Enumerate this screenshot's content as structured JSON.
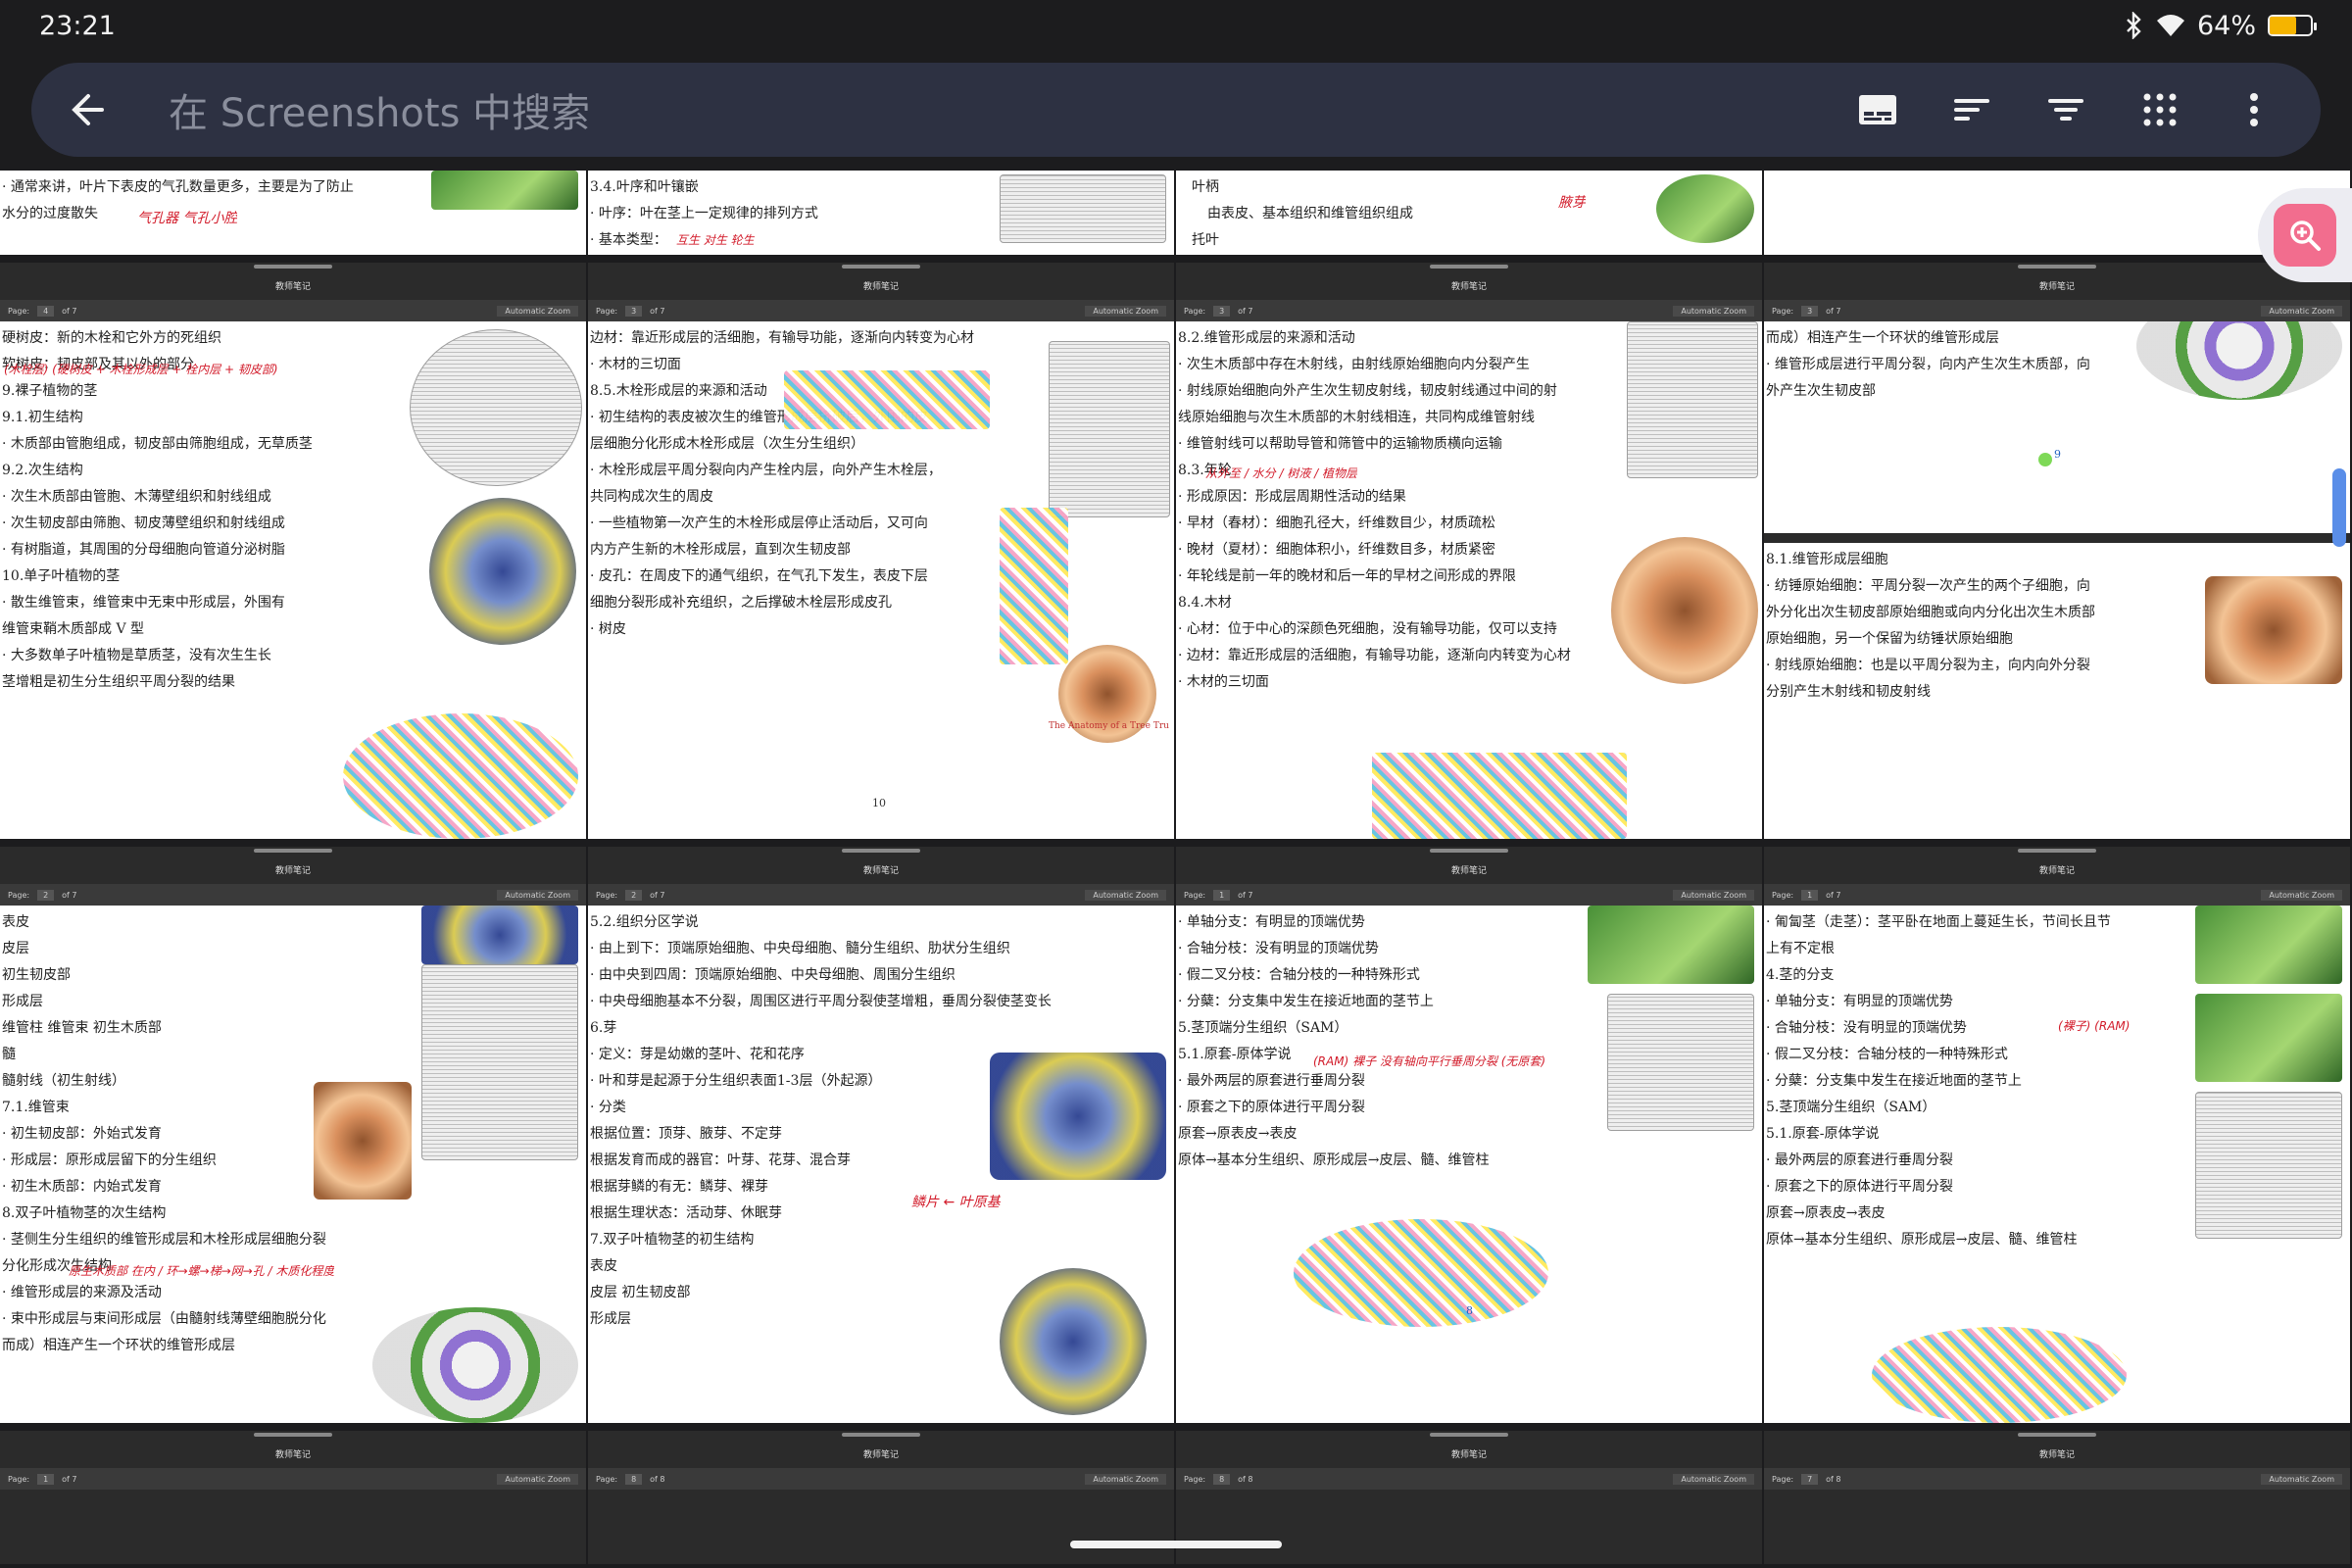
{
  "status": {
    "time": "23:21",
    "battery": "64%",
    "battery_color": "#f5b400",
    "battery_level": 0.64
  },
  "search": {
    "placeholder": "在 Screenshots 中搜索"
  },
  "tool_icons": [
    "subtitles-icon",
    "sort-icon",
    "filter-icon",
    "grid-icon",
    "more-vert-icon"
  ],
  "header_title": "教师笔记",
  "zoom_label": "Automatic Zoom",
  "row0": [
    {
      "lines": [
        "· 通常来讲，叶片下表皮的气孔数量更多，主要是为了防止",
        "水分的过度散失"
      ],
      "red": "气孔器 气孔小腔",
      "fig": "green"
    },
    {
      "lines": [
        "3.4.叶序和叶镶嵌",
        "· 叶序：叶在茎上一定规律的排列方式",
        "· 基本类型："
      ],
      "red": "互生 对生 轮生",
      "fig": "sketch"
    },
    {
      "lines": [
        "叶柄",
        "由表皮、基本组织和维管组织组成",
        "托叶"
      ],
      "red": "腋芽",
      "fig": "green"
    },
    {
      "lines": [],
      "red": "",
      "fig": ""
    }
  ],
  "row1": [
    {
      "page": "4",
      "of": "of 7",
      "lines": [
        "硬树皮：新的木栓和它外方的死组织",
        "软树皮：韧皮部及其以外的部分",
        "",
        "9.裸子植物的茎",
        "9.1.初生结构",
        "· 木质部由管胞组成，韧皮部由筛胞组成，无草质茎",
        "",
        "9.2.次生结构",
        "· 次生木质部由管胞、木薄壁组织和射线组成",
        "· 次生韧皮部由筛胞、韧皮薄壁组织和射线组成",
        "· 有树脂道，其周围的分母细胞向管道分泌树脂",
        "",
        "10.单子叶植物的茎",
        "· 散生维管束，维管束中无束中形成层，外围有",
        "维管束鞘木质部成 V 型",
        "· 大多数单子叶植物是草质茎，没有次生生长",
        "茎增粗是初生分生组织平周分裂的结果"
      ],
      "red": "(木栓层) (硬树皮 + 木栓形成层 + 栓内层 + 韧皮部)"
    },
    {
      "page": "3",
      "of": "of 7",
      "lines": [
        "边材：靠近形成层的活细胞，有输导功能，逐渐向内转变为心材",
        "· 木材的三切面",
        "",
        "",
        "8.5.木栓形成层的来源和活动",
        "· 初生结构的表皮被次生的维管形成层挤破后，外围的皮",
        "层细胞分化形成木栓形成层（次生分生组织）",
        "· 木栓形成层平周分裂向内产生栓内层，向外产生木栓层，",
        "共同构成次生的周皮",
        "· 一些植物第一次产生的木栓形成层停止活动后，又可向",
        "内方产生新的木栓形成层，直到次生韧皮部",
        "· 皮孔：在周皮下的通气组织，在气孔下发生，表皮下层",
        "细胞分裂形成补充组织，之后撑破木栓层形成皮孔",
        "· 树皮"
      ],
      "pagenum": "10",
      "caption": "The Anatomy of a Tree Tru"
    },
    {
      "page": "3",
      "of": "of 7",
      "lines": [
        "8.2.维管形成层的来源和活动",
        "· 次生木质部中存在木射线，由射线原始细胞向内分裂产生",
        "· 射线原始细胞向外产生次生韧皮射线，韧皮射线通过中间的射",
        "线原始细胞与次生木质部的木射线相连，共同构成维管射线",
        "· 维管射线可以帮助导管和筛管中的运输物质横向运输",
        "",
        "8.3.年轮",
        "· 形成原因：形成层周期性活动的结果",
        "· 早材（春材）：细胞孔径大，纤维数目少，材质疏松",
        "· 晚材（夏材）：细胞体积小，纤维数目多，材质紧密",
        "· 年轮线是前一年的晚材和后一年的早材之间形成的界限",
        "",
        "8.4.木材",
        "· 心材：位于中心的深颜色死细胞，没有输导功能，仅可以支持",
        "· 边材：靠近形成层的活细胞，有输导功能，逐渐向内转变为心材",
        "· 木材的三切面"
      ],
      "red": "从外至 / 水分 / 树液 / 植物层"
    },
    {
      "page": "3",
      "of": "of 7",
      "lines": [
        "而成）相连产生一个环状的维管形成层",
        "· 维管形成层进行平周分裂，向内产生次生木质部，向",
        "外产生次生韧皮部"
      ],
      "lines2": [
        "8.1.维管形成层细胞",
        "· 纺锤原始细胞：平周分裂一次产生的两个子细胞，向",
        "外分化出次生韧皮部原始细胞或向内分化出次生木质部",
        "原始细胞，另一个保留为纺锤状原始细胞",
        "· 射线原始细胞：也是以平周分裂为主，向内向外分裂",
        "分别产生木射线和韧皮射线"
      ],
      "marker": "9"
    }
  ],
  "row2": [
    {
      "page": "2",
      "of": "of 7",
      "lines": [
        "  表皮",
        "",
        "  皮层",
        "                                初生韧皮部",
        "                                形成层",
        "  维管柱            维管束      初生木质部",
        "                        髓",
        "                        髓射线（初生射线）",
        "",
        "7.1.维管束",
        "· 初生韧皮部：外始式发育",
        "· 形成层：原形成层留下的分生组织",
        "· 初生木质部：内始式发育",
        "",
        "8.双子叶植物茎的次生结构",
        "· 茎侧生分生组织的维管形成层和木栓形成层细胞分裂",
        "分化形成次生结构",
        "· 维管形成层的来源及活动",
        "· 束中形成层与束间形成层（由髓射线薄壁细胞脱分化",
        "而成）相连产生一个环状的维管形成层"
      ],
      "red": "原生木质部 在内 / 环→螺→梯→网→孔 / 木质化程度"
    },
    {
      "page": "2",
      "of": "of 7",
      "lines": [
        "5.2.组织分区学说",
        "· 由上到下：顶端原始细胞、中央母细胞、髓分生组织、肋状分生组织",
        "· 由中央到四周：顶端原始细胞、中央母细胞、周围分生组织",
        "· 中央母细胞基本不分裂，周围区进行平周分裂使茎增粗，垂周分裂使茎变长",
        "",
        "6.芽",
        "· 定义：芽是幼嫩的茎叶、花和花序",
        "· 叶和芽是起源于分生组织表面1-3层（外起源）",
        "· 分类",
        "根据位置：顶芽、腋芽、不定芽",
        "根据发育而成的器官：叶芽、花芽、混合芽",
        "根据芽鳞的有无：鳞芽、裸芽",
        "根据生理状态：活动芽、休眠芽",
        "",
        "7.双子叶植物茎的初生结构",
        "  表皮",
        "",
        "  皮层                     初生韧皮部",
        "                              形成层"
      ],
      "red": "鳞片 ← 叶原基"
    },
    {
      "page": "1",
      "of": "of 7",
      "lines": [
        "· 单轴分支：有明显的顶端优势",
        "· 合轴分枝：没有明显的顶端优势",
        "· 假二叉分枝：合轴分枝的一种特殊形式",
        "· 分蘖：分支集中发生在接近地面的茎节上",
        "",
        "5.茎顶端分生组织（SAM）",
        "5.1.原套-原体学说",
        "· 最外两层的原套进行垂周分裂",
        "· 原套之下的原体进行平周分裂",
        "  原套→原表皮→表皮",
        "  原体→基本分生组织、原形成层→皮层、髓、维管柱"
      ],
      "red": "(RAM) 裸子 没有轴向平行垂周分裂 (无原套)",
      "marker": "8"
    },
    {
      "page": "1",
      "of": "of 7",
      "lines": [
        "· 匍匐茎（走茎）：茎平卧在地面上蔓延生长，节间长且节",
        "上有不定根",
        "",
        "4.茎的分支",
        "· 单轴分支：有明显的顶端优势",
        "· 合轴分枝：没有明显的顶端优势",
        "· 假二叉分枝：合轴分枝的一种特殊形式",
        "· 分蘖：分支集中发生在接近地面的茎节上",
        "",
        "5.茎顶端分生组织（SAM）",
        "5.1.原套-原体学说",
        "· 最外两层的原套进行垂周分裂",
        "· 原套之下的原体进行平周分裂",
        "  原套→原表皮→表皮",
        "  原体→基本分生组织、原形成层→皮层、髓、维管柱"
      ],
      "red": "(裸子) (RAM)"
    }
  ],
  "row3": [
    {
      "page": "1",
      "of": "of 7"
    },
    {
      "page": "8",
      "of": "of 8"
    },
    {
      "page": "8",
      "of": "of 8"
    },
    {
      "page": "7",
      "of": "of 8"
    }
  ]
}
